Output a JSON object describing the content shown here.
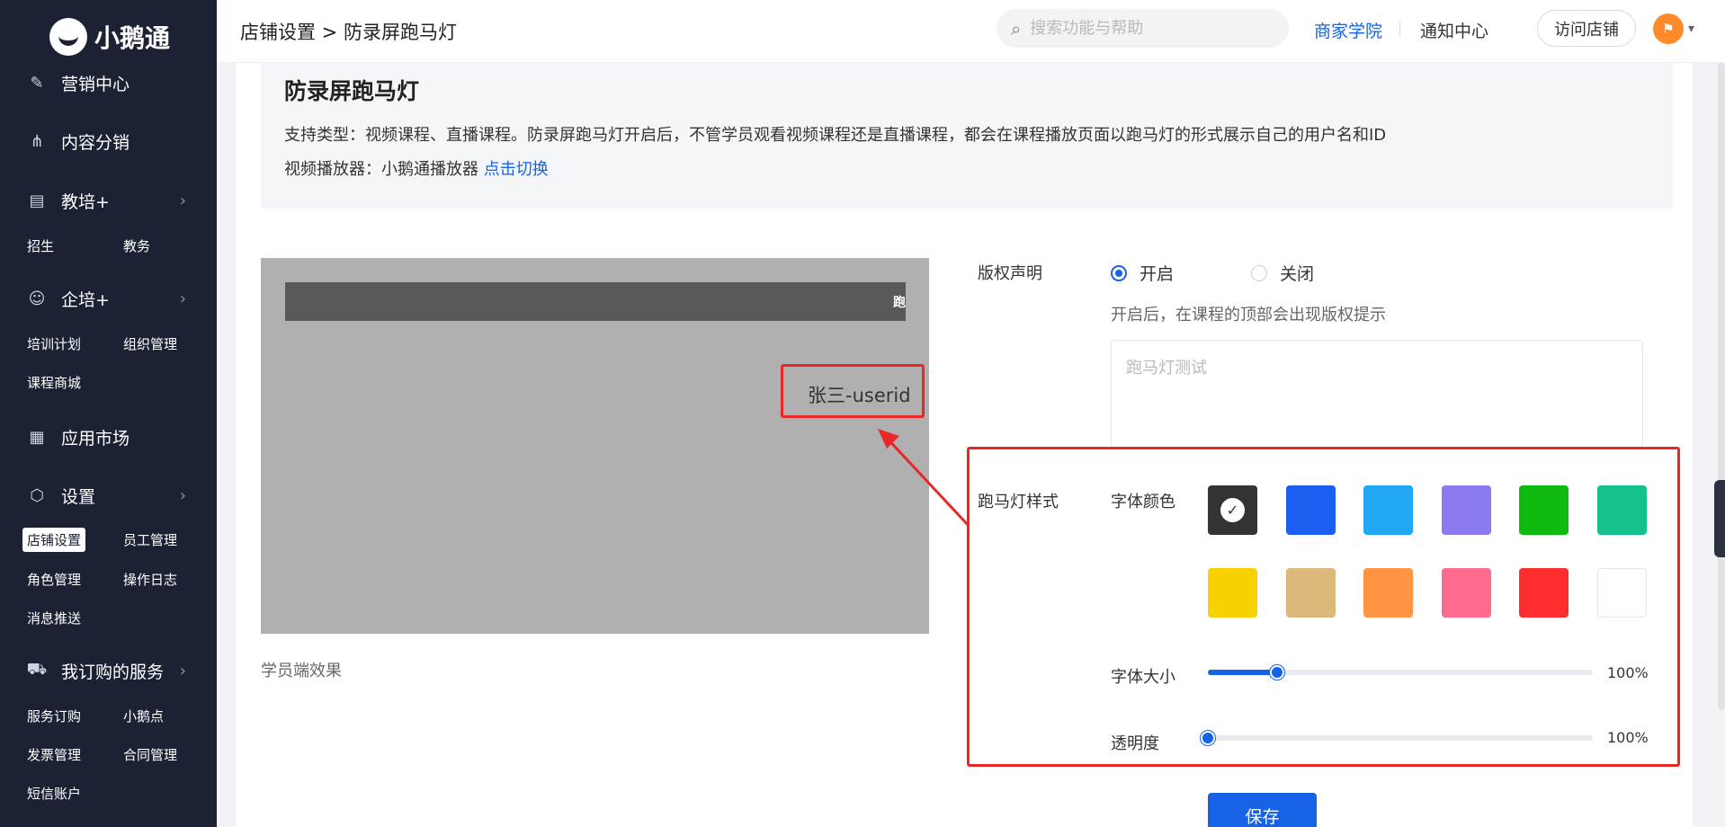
{
  "sidebar": {
    "logo_text": "小鹅通",
    "groups": {
      "marketing": "营销中心",
      "content_dist": "内容分销",
      "edu": "教培+",
      "enterprise": "企培+",
      "app_market": "应用市场",
      "settings": "设置",
      "services": "我订购的服务"
    },
    "subs": {
      "recruit": "招生",
      "academic": "教务",
      "training_plan": "培训计划",
      "org_manage": "组织管理",
      "course_mall": "课程商城",
      "shop_settings": "店铺设置",
      "staff_manage": "员工管理",
      "role_manage": "角色管理",
      "op_log": "操作日志",
      "msg_push": "消息推送",
      "service_order": "服务订购",
      "xiao_e_points": "小鹅点",
      "invoice": "发票管理",
      "contract": "合同管理",
      "sms_account": "短信账户"
    }
  },
  "header": {
    "breadcrumb": "店铺设置 > 防录屏跑马灯",
    "search_placeholder": "搜索功能与帮助",
    "merchant_academy": "商家学院",
    "notice_center": "通知中心",
    "visit_shop": "访问店铺"
  },
  "info": {
    "title": "防录屏跑马灯",
    "desc": "支持类型：视频课程、直播课程。防录屏跑马灯开启后，不管学员观看视频课程还是直播课程，都会在课程播放页面以跑马灯的形式展示自己的用户名和ID",
    "player_prefix": "视频播放器：小鹅通播放器 ",
    "player_switch": "点击切换"
  },
  "preview": {
    "bar_text": "跑",
    "marquee_text": "张三-userid",
    "caption": "学员端效果"
  },
  "copyright": {
    "label": "版权声明",
    "on_label": "开启",
    "off_label": "关闭",
    "selected": "on",
    "hint": "开启后，在课程的顶部会出现版权提示",
    "text_placeholder": "跑马灯测试"
  },
  "style": {
    "label": "跑马灯样式",
    "font_color_label": "字体颜色",
    "colors": [
      "#333333",
      "#1a5ff0",
      "#22a7f4",
      "#8a7cf0",
      "#0fba0f",
      "#16c08c",
      "#f8d200",
      "#dcb87a",
      "#ff9543",
      "#ff6b8f",
      "#fe2e2e",
      "#ffffff"
    ],
    "selected_color_index": 0,
    "font_size_label": "字体大小",
    "font_size_value": "100%",
    "font_size_level": 0.18,
    "opacity_label": "透明度",
    "opacity_value": "100%",
    "opacity_level": 0.0
  },
  "save_label": "保存"
}
